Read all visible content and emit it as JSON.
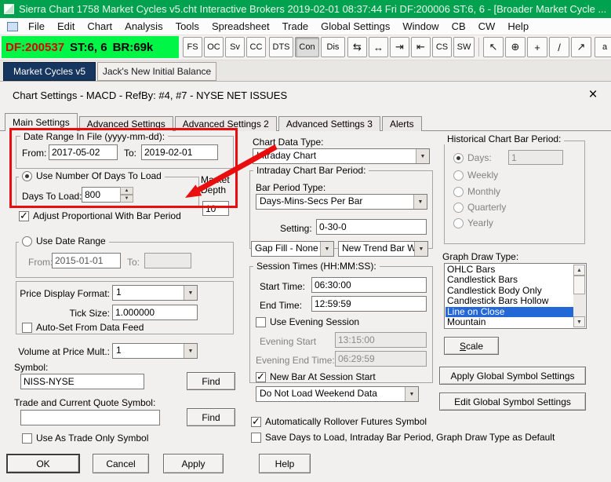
{
  "colors": {
    "title_bar_green": "#00a24f",
    "status_bright_green": "#00f646",
    "status_df_red": "#dd0000",
    "active_chart_tab_navy": "#17365f",
    "list_selection_blue": "#2467d6",
    "annotation_red": "#ea0d0d"
  },
  "app": {
    "title": "Sierra Chart 1758 Market Cycles v5.cht  Interactive Brokers 2019-02-01  08:37:44 Fri  DF:200006  ST:6, 6  - [Broader Market Cycle ...",
    "menu": [
      "File",
      "Edit",
      "Chart",
      "Analysis",
      "Tools",
      "Spreadsheet",
      "Trade",
      "Global Settings",
      "Window",
      "CB",
      "CW",
      "Help"
    ],
    "toolbar": {
      "df": "DF:200537",
      "st": "ST:6, 6",
      "br": "BR:69k",
      "text_buttons": [
        "FS",
        "OC",
        "Sv",
        "CC",
        "DTS",
        "Con",
        "Dis"
      ],
      "icon_buttons": [
        {
          "name": "swap-bars-icon",
          "glyph": "⇆"
        },
        {
          "name": "fit-width-icon",
          "glyph": "↔"
        },
        {
          "name": "scroll-end-icon",
          "glyph": "⇥"
        },
        {
          "name": "scroll-start-icon",
          "glyph": "⇤"
        }
      ],
      "text_buttons2": [
        "CS",
        "SW"
      ],
      "tool_icons": [
        {
          "name": "pointer-tool-icon",
          "glyph": "↖"
        },
        {
          "name": "crosshair-tool-icon",
          "glyph": "⊕"
        },
        {
          "name": "plus-tool-icon",
          "glyph": "+"
        },
        {
          "name": "line-tool-icon",
          "glyph": "/"
        },
        {
          "name": "trendline-tool-icon",
          "glyph": "↗"
        }
      ],
      "text_tool": "a"
    },
    "chart_tabs": [
      "Market Cycles v5",
      "Jack's New Initial Balance"
    ]
  },
  "dialog": {
    "title": "Chart Settings - MACD - RefBy: #4, #7  - NYSE NET ISSUES",
    "tabs": [
      "Main Settings",
      "Advanced Settings",
      "Advanced Settings 2",
      "Advanced Settings 3",
      "Alerts"
    ],
    "date_range_in_file": {
      "legend": "Date Range In File (yyyy-mm-dd):",
      "from_label": "From:",
      "from_value": "2017-05-02",
      "to_label": "To:",
      "to_value": "2019-02-01"
    },
    "days_to_load": {
      "radio_label": "Use Number Of Days To Load",
      "field_label": "Days To Load:",
      "value": "800"
    },
    "market_depth": {
      "label": "Market Depth",
      "value": "10"
    },
    "adjust_proportional_label": "Adjust Proportional With Bar Period",
    "use_date_range": {
      "radio_label": "Use Date Range",
      "from_label": "From:",
      "from_value": "2015-01-01",
      "to_label": "To:",
      "to_value": ""
    },
    "price_format": {
      "display_label": "Price Display Format:",
      "display_value": "1",
      "tick_label": "Tick Size:",
      "tick_value": "1.000000",
      "autoset_label": "Auto-Set From Data Feed"
    },
    "volume_mult": {
      "label": "Volume at Price Mult.:",
      "value": "1"
    },
    "symbol": {
      "label": "Symbol:",
      "value": "NISS-NYSE",
      "find_label": "Find"
    },
    "trade_symbol": {
      "label": "Trade and Current Quote Symbol:",
      "value": "",
      "find_label": "Find",
      "use_trade_only_label": "Use As Trade Only Symbol"
    },
    "chart_data_type": {
      "label": "Chart Data Type:",
      "value": "Intraday Chart"
    },
    "intraday_bar_period": {
      "legend": "Intraday Chart Bar Period:",
      "bar_period_type_label": "Bar Period Type:",
      "bar_period_type_value": "Days-Mins-Secs Per Bar",
      "setting_label": "Setting:",
      "setting_value": "0-30-0",
      "gap_fill_value": "Gap Fill - None",
      "new_trend_bar_value": "New Trend Bar W"
    },
    "session_times": {
      "legend": "Session Times (HH:MM:SS):",
      "start_label": "Start Time:",
      "start_value": "06:30:00",
      "end_label": "End Time:",
      "end_value": "12:59:59",
      "evening_checkbox_label": "Use Evening Session",
      "evening_start_label": "Evening Start",
      "evening_start_value": "13:15:00",
      "evening_end_label": "Evening End Time:",
      "evening_end_value": "06:29:59",
      "new_bar_label": "New Bar At Session Start",
      "weekend_value": "Do Not Load Weekend Data"
    },
    "rollover_label": "Automatically Rollover Futures Symbol",
    "save_defaults_label": "Save Days to Load, Intraday Bar Period, Graph Draw Type as Default",
    "historical_bar_period": {
      "legend": "Historical Chart Bar Period:",
      "options": [
        "Days:",
        "Weekly",
        "Monthly",
        "Quarterly",
        "Yearly"
      ],
      "days_value": "1"
    },
    "graph_draw_type": {
      "label": "Graph Draw Type:",
      "items": [
        "OHLC Bars",
        "Candlestick Bars",
        "Candlestick Body Only",
        "Candlestick Bars Hollow",
        "Line on Close",
        "Mountain"
      ],
      "selected": "Line on Close"
    },
    "buttons": {
      "scale": "Scale",
      "apply_global": "Apply Global Symbol Settings",
      "edit_global": "Edit Global Symbol Settings",
      "ok": "OK",
      "cancel": "Cancel",
      "apply": "Apply",
      "help": "Help"
    }
  }
}
